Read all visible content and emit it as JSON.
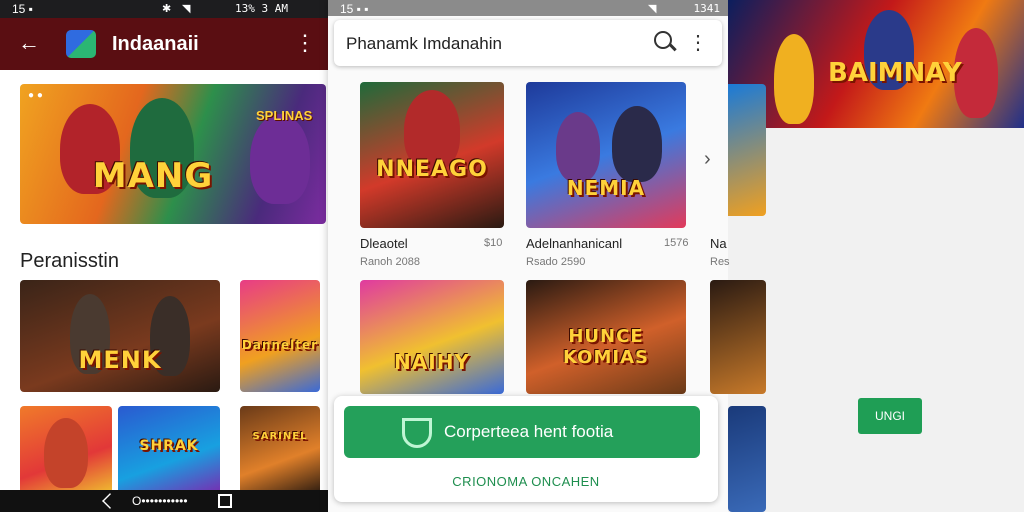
{
  "left_phone": {
    "status": {
      "left_icons": "15 ▪",
      "time": "13% 3 AM"
    },
    "app_bar": {
      "title": "Indaanaii",
      "back_icon": "arrow-left-icon",
      "menu_icon": "more-vert-icon"
    },
    "banner": {
      "badge": "● ●",
      "caption": "MANG",
      "subcaption": "SPLINAS"
    },
    "section_title": "Peranisstin",
    "grid": [
      {
        "caption": "MENK"
      },
      {
        "caption": "Dannelter"
      },
      {
        "caption": ""
      },
      {
        "caption": "SHRAK"
      },
      {
        "caption": "SARINEL"
      }
    ],
    "nav": {
      "label": "Ο•••••••••••"
    }
  },
  "middle_phone": {
    "status": {
      "left_icons": "15 ▪ ▪",
      "time": "1341"
    },
    "search": {
      "text": "Phanamk Imdanahin"
    },
    "games": [
      {
        "caption": "NNEAGO",
        "name": "Dleaotel",
        "size": "$10",
        "sub": "Ranoh 2088"
      },
      {
        "caption": "NEMIA",
        "name": "Adelnanhanicanl",
        "size": "1576",
        "sub": "Rsado 2590"
      },
      {
        "caption": "NAIHY",
        "name": "",
        "size": "",
        "sub": ""
      },
      {
        "caption": "HUNCE KOMIAS",
        "name": "",
        "size": "",
        "sub": ""
      }
    ],
    "install": {
      "label": "Corperteea hent footia",
      "link": "CRIONOMA ONCAHEN"
    }
  },
  "right_panel": {
    "banner": {
      "caption": "BAIMNAY"
    },
    "peek_name": "Na",
    "peek_sub": "Res",
    "ok_label": "UNGI"
  },
  "colors": {
    "appbar": "#5a0e12",
    "install_green": "#24a05a",
    "ok_green": "#1f9e55"
  }
}
